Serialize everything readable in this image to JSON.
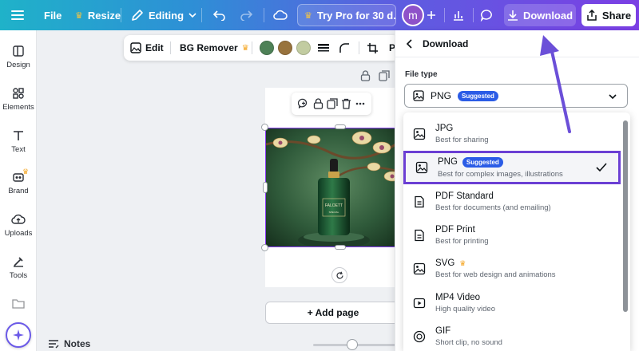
{
  "topbar": {
    "file": "File",
    "resize": "Resize",
    "editing": "Editing",
    "try_pro": "Try Pro for 30 d...",
    "avatar_initial": "m",
    "download": "Download",
    "share": "Share"
  },
  "sidebar": {
    "items": [
      {
        "label": "Design",
        "icon": "design-icon"
      },
      {
        "label": "Elements",
        "icon": "elements-icon"
      },
      {
        "label": "Text",
        "icon": "text-icon"
      },
      {
        "label": "Brand",
        "icon": "brand-icon"
      },
      {
        "label": "Uploads",
        "icon": "uploads-icon"
      },
      {
        "label": "Tools",
        "icon": "tools-icon"
      }
    ]
  },
  "context_toolbar": {
    "edit": "Edit",
    "bg_remover": "BG Remover",
    "swatches": [
      "#4e8157",
      "#98733d",
      "#c2cca1"
    ],
    "overflow_letter": "P"
  },
  "canvas": {
    "product_brand": "FALOETT",
    "product_sub": "SPECIAL",
    "add_page": "+ Add page",
    "notes": "Notes"
  },
  "download_panel": {
    "title": "Download",
    "file_type_label": "File type",
    "selected_value": "PNG",
    "suggested": "Suggested",
    "options": [
      {
        "name": "JPG",
        "desc": "Best for sharing"
      },
      {
        "name": "PNG",
        "desc": "Best for complex images, illustrations",
        "badge": "Suggested"
      },
      {
        "name": "PDF Standard",
        "desc": "Best for documents (and emailing)"
      },
      {
        "name": "PDF Print",
        "desc": "Best for printing"
      },
      {
        "name": "SVG",
        "desc": "Best for web design and animations"
      },
      {
        "name": "MP4 Video",
        "desc": "High quality video"
      },
      {
        "name": "GIF",
        "desc": "Short clip, no sound"
      }
    ]
  },
  "colors": {
    "accent": "#6b3fd4",
    "badge": "#2b5ce6",
    "arrow": "#6b4fd8",
    "crown": "#f5a623"
  }
}
